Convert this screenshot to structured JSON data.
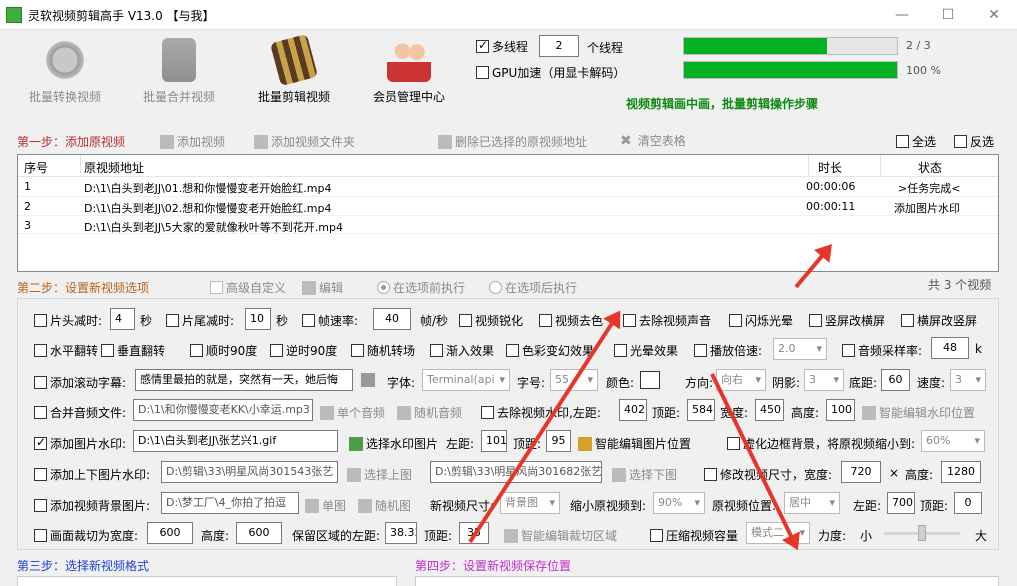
{
  "window": {
    "title": "灵软视频剪辑高手 V13.0 【与我】",
    "min": "—",
    "max": "☐",
    "close": "✕"
  },
  "toolbar": {
    "batch_convert": "批量转换视频",
    "batch_merge": "批量合并视频",
    "batch_edit": "批量剪辑视频",
    "member_center": "会员管理中心"
  },
  "threads": {
    "multi_label": "多线程",
    "multi_checked": true,
    "count": "2",
    "unit": "个线程",
    "gpu_label": "GPU加速（用显卡解码）",
    "gpu_checked": false
  },
  "progress": {
    "p1_text": "2 / 3",
    "p1_fraction": 0.67,
    "p2_text": "100 %",
    "p2_fraction": 1.0,
    "status": "视频剪辑画中画，批量剪辑操作步骤"
  },
  "step1": {
    "num": "第一步：",
    "title": "添加原视频",
    "add_video": "添加视频",
    "add_folder": "添加视频文件夹",
    "delete_selected": "删除已选择的原视频地址",
    "clear_list": "清空表格",
    "select_all": "全选",
    "invert": "反选"
  },
  "grid": {
    "headers": [
      "序号",
      "原视频地址",
      "时长",
      "状态"
    ],
    "rows": [
      {
        "idx": "1",
        "path": "D:\\1\\白头到老JJ\\01.想和你慢慢变老开始脸红.mp4",
        "dur": "00:00:06",
        "status": ">任务完成<"
      },
      {
        "idx": "2",
        "path": "D:\\1\\白头到老JJ\\02.想和你慢慢变老开始脸红.mp4",
        "dur": "00:00:11",
        "status": "添加图片水印"
      },
      {
        "idx": "3",
        "path": "D:\\1\\白头到老JJ\\5大家的爱就像秋叶等不到花开.mp4",
        "dur": "",
        "status": ""
      }
    ]
  },
  "step2": {
    "num": "第二步：",
    "title": "设置新视频选项",
    "advanced": "高级自定义",
    "edit": "编辑",
    "before": "在选项前执行",
    "after": "在选项后执行",
    "total": "共 3 个视频"
  },
  "opts": {
    "r1": {
      "head_cut": "片头减时:",
      "head_val": "4",
      "sec": "秒",
      "tail_cut": "片尾减时:",
      "tail_val": "10",
      "sec2": "秒",
      "fps": "帧速率:",
      "fps_val": "40",
      "fps_unit": "帧/秒",
      "sharpen": "视频锐化",
      "decolor": "视频去色",
      "mute": "去除视频声音",
      "flash": "闪烁光晕",
      "v2h": "竖屏改横屏",
      "h2v": "横屏改竖屏"
    },
    "r2": {
      "hflip": "水平翻转",
      "vflip": "垂直翻转",
      "cw90": "顺时90度",
      "ccw90": "逆时90度",
      "rand_trans": "随机转场",
      "fade_in": "渐入效果",
      "color_effect": "色彩变幻效果",
      "halo": "光晕效果",
      "speed": "播放倍速:",
      "speed_val": "2.0",
      "sample": "音频采样率:",
      "sample_val": "48",
      "sample_unit": "k"
    },
    "r3": {
      "scroll": "添加滚动字幕:",
      "scroll_text": "感情里最拍的就是，突然有一天，她后悔",
      "font": "字体:",
      "font_val": "Terminal(api",
      "size": "字号:",
      "size_val": "55",
      "color": "颜色:",
      "dir": "方向:",
      "dir_val": "向右",
      "shadow": "阴影:",
      "shadow_val": "3",
      "bottom": "底距:",
      "bottom_val": "60",
      "speed": "速度:",
      "speed_val": "3"
    },
    "r4": {
      "merge_audio": "合并音频文件:",
      "audio_path": "D:\\1\\和你慢慢变老KK\\小幸运.mp3",
      "single": "单个音频",
      "random": "随机音频",
      "remove_wm": "去除视频水印,",
      "left": "左距:",
      "left_val": "402",
      "top": "顶距:",
      "top_val": "584",
      "width": "宽度:",
      "width_val": "450",
      "height": "高度:",
      "height_val": "100",
      "smart": "智能编辑水印位置"
    },
    "r5": {
      "img_wm": "添加图片水印:",
      "img_path": "D:\\1\\白头到老JJ\\张艺兴1.gif",
      "choose": "选择水印图片",
      "left": "左距:",
      "left_val": "101",
      "top": "顶距:",
      "top_val": "95",
      "smart": "智能编辑图片位置",
      "blur": "虚化边框背景，将原视频缩小到:",
      "blur_val": "60%"
    },
    "r6": {
      "tb_wm": "添加上下图片水印:",
      "top_path": "D:\\剪辑\\33\\明星风尚301543张艺",
      "choose_top": "选择上图",
      "bottom_path": "D:\\剪辑\\33\\明星风尚301682张艺",
      "choose_bottom": "选择下图",
      "modify": "修改视频尺寸，宽度:",
      "w": "720",
      "x": "×",
      "h_label": "高度:",
      "h": "1280"
    },
    "r7": {
      "bg": "添加视频背景图片:",
      "bg_path": "D:\\梦工厂\\4_你拍了拍逗",
      "single": "单图",
      "random": "随机图",
      "new_size": "新视频尺寸:",
      "new_size_val": "背景图",
      "shrink": "缩小原视频到:",
      "shrink_val": "90%",
      "pos": "原视频位置:",
      "pos_val": "居中",
      "left": "左距:",
      "left_val": "700",
      "top": "顶距:",
      "top_val": "0"
    },
    "r8": {
      "crop": "画面裁切为宽度:",
      "crop_w": "600",
      "h_label": "高度:",
      "crop_h": "600",
      "keep_left": "保留区域的左距:",
      "keep_left_val": "38.33",
      "top": "顶距:",
      "top_val": "35",
      "smart": "智能编辑裁切区域",
      "compress": "压缩视频容量",
      "mode_val": "模式二",
      "strength": "力度:",
      "small": "小",
      "big": "大",
      "strength_level": 0.5
    }
  },
  "step3": {
    "num": "第三步：",
    "title": "选择新视频格式"
  },
  "step4": {
    "num": "第四步：",
    "title": "设置新视频保存位置"
  },
  "colors": {
    "accent_red": "#b8312f",
    "progress_green": "#06b025",
    "status_green": "#0c8a12",
    "step3_blue": "#1d3fd6",
    "step4_purple": "#c02ccf"
  }
}
